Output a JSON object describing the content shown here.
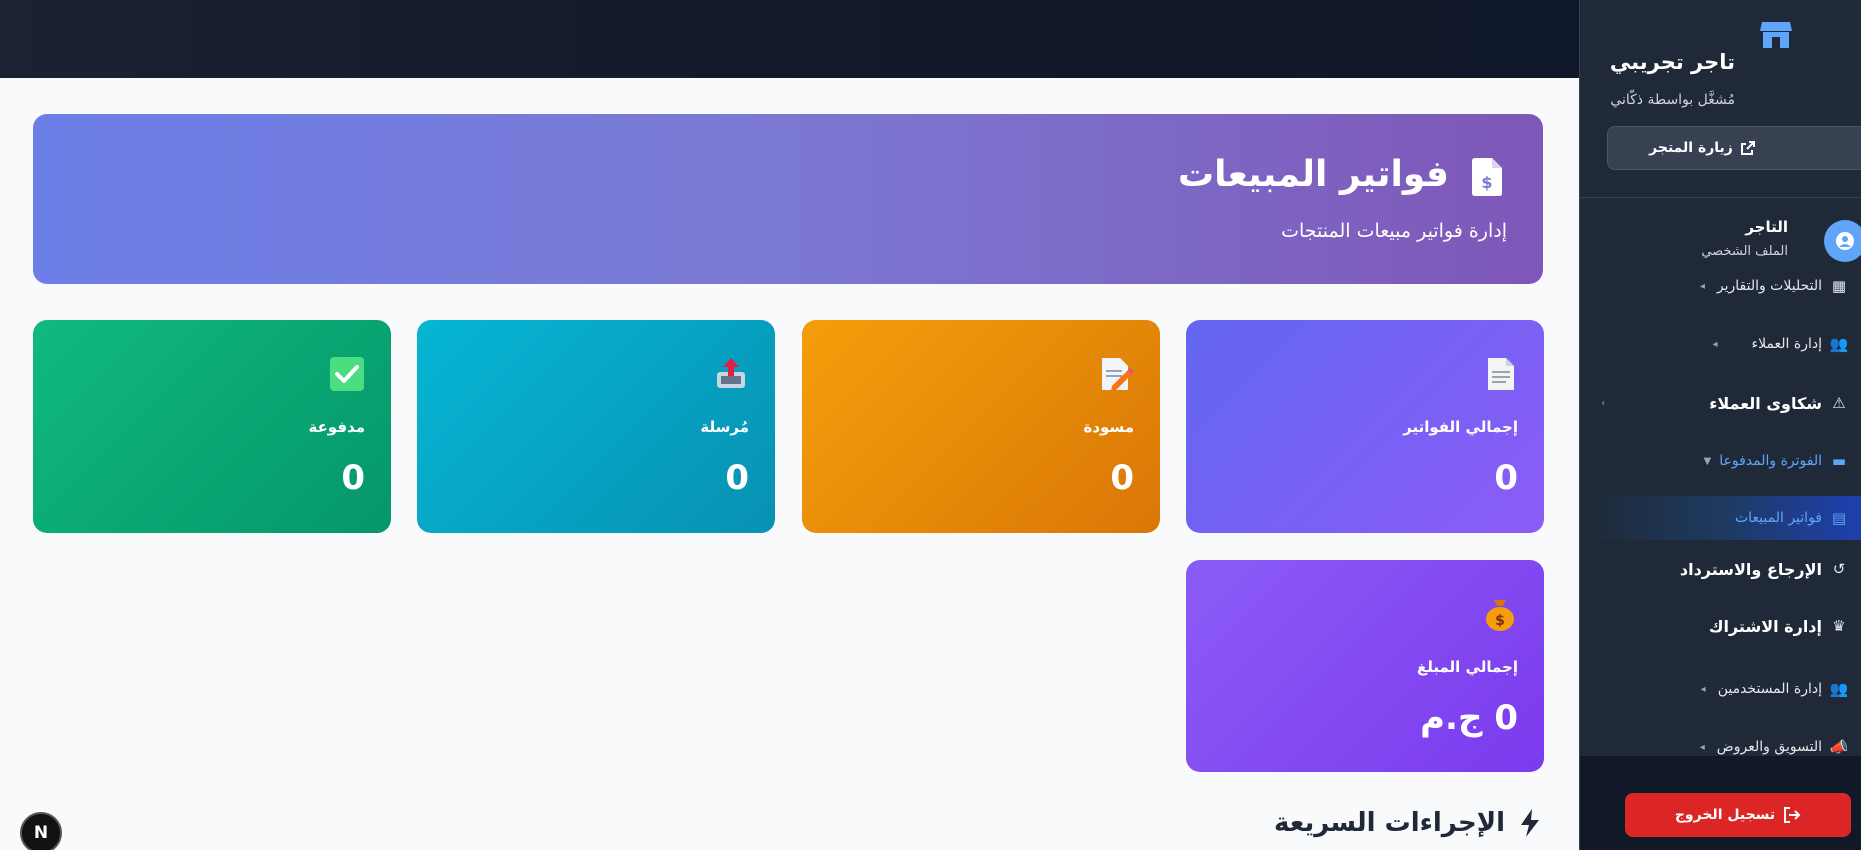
{
  "sidebar": {
    "store_name": "تاجر تجريبي",
    "store_subtitle": "مُشغَّل بواسطة ذكّاني",
    "visit_store_label": "زيارة المتجر",
    "profile": {
      "name": "التاجر",
      "subtitle": "الملف الشخصي"
    },
    "items": [
      {
        "label": "التحليلات والتقارير",
        "icon": "chart-icon"
      },
      {
        "label": "إدارة العملاء",
        "icon": "users-icon"
      },
      {
        "label": "شكاوى العملاء",
        "icon": "warning-icon"
      },
      {
        "label": "الفوترة والمدفوعا",
        "icon": "credit-card-icon"
      },
      {
        "label": "فواتير المبيعات",
        "icon": "receipt-icon"
      },
      {
        "label": "الإرجاع والاسترداد",
        "icon": "undo-icon"
      },
      {
        "label": "إدارة الاشتراك",
        "icon": "crown-icon"
      },
      {
        "label": "إدارة المستخدمين",
        "icon": "users-cog-icon"
      },
      {
        "label": "التسويق والعروض",
        "icon": "megaphone-icon"
      }
    ],
    "logout_label": "تسجيل الخروج"
  },
  "hero": {
    "title": "فواتير المبيعات",
    "subtitle": "إدارة فواتير مبيعات المنتجات"
  },
  "stats": {
    "total": {
      "label": "إجمالي الفواتير",
      "value": "0"
    },
    "draft": {
      "label": "مسودة",
      "value": "0"
    },
    "sent": {
      "label": "مُرسلة",
      "value": "0"
    },
    "paid": {
      "label": "مدفوعة",
      "value": "0"
    },
    "amount": {
      "label": "إجمالي المبلغ",
      "value": "0 ج.م"
    }
  },
  "quick_actions": {
    "title": "الإجراءات السريعة"
  },
  "dev_badge": "N",
  "colors": {
    "sidebar_bg": "#1f2937",
    "accent_blue": "#60a5fa",
    "logout_red": "#dc2626"
  }
}
